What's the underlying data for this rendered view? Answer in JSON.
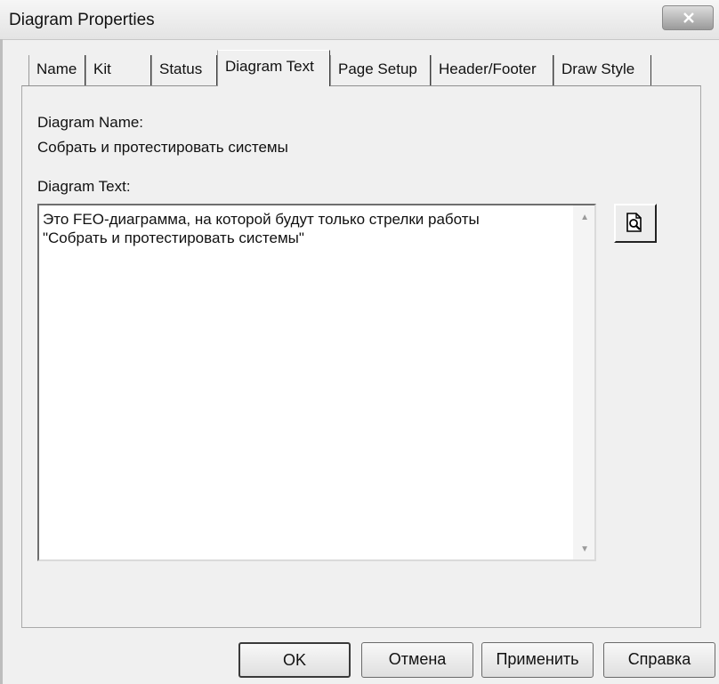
{
  "window": {
    "title": "Diagram Properties"
  },
  "tabs": [
    "Name",
    "Kit",
    "Status",
    "Diagram Text",
    "Page Setup",
    "Header/Footer",
    "Draw Style"
  ],
  "active_tab": "Diagram Text",
  "form": {
    "diagram_name_label": "Diagram Name:",
    "diagram_name_value": "Собрать и протестировать системы",
    "diagram_text_label": "Diagram Text:",
    "diagram_text_value": "Это FEO-диаграмма, на которой будут только стрелки работы\n\"Собрать и протестировать системы\""
  },
  "buttons": {
    "ok": "OK",
    "cancel": "Отмена",
    "apply": "Применить",
    "help": "Справка"
  },
  "icons": {
    "close": "close-icon",
    "preview": "magnifier-page-icon"
  }
}
